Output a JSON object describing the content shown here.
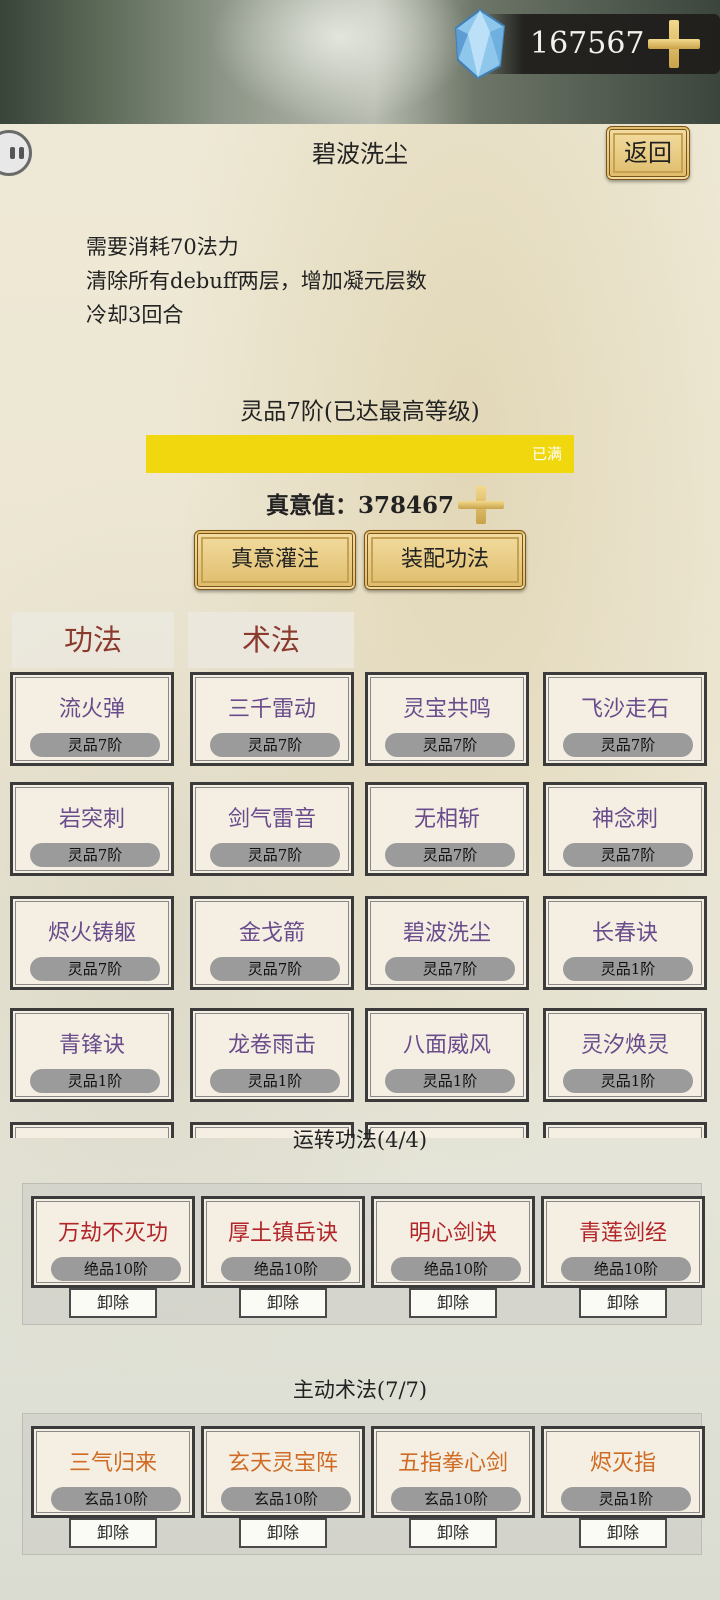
{
  "currency": {
    "value": "167567",
    "icon": "diamond-gem-icon",
    "add_icon": "plus-icon"
  },
  "skill": {
    "title": "碧波洗尘",
    "back_label": "返回",
    "description": [
      "需要消耗70法力",
      "清除所有debuff两层，增加凝元层数",
      "冷却3回合"
    ],
    "level_title": "灵品7阶(已达最高等级)",
    "progress": {
      "fraction": 1.0,
      "label": "已满",
      "fill_color": "#f0d70e"
    },
    "essence_label": "真意值：",
    "essence_value": "378467",
    "infuse_label": "真意灌注",
    "equip_label": "装配功法"
  },
  "tabs": [
    "功法",
    "术法"
  ],
  "skills": [
    {
      "name": "流火弹",
      "grade": "灵品7阶"
    },
    {
      "name": "三千雷动",
      "grade": "灵品7阶"
    },
    {
      "name": "灵宝共鸣",
      "grade": "灵品7阶"
    },
    {
      "name": "飞沙走石",
      "grade": "灵品7阶"
    },
    {
      "name": "岩突刺",
      "grade": "灵品7阶"
    },
    {
      "name": "剑气雷音",
      "grade": "灵品7阶"
    },
    {
      "name": "无相斩",
      "grade": "灵品7阶"
    },
    {
      "name": "神念刺",
      "grade": "灵品7阶"
    },
    {
      "name": "烬火铸躯",
      "grade": "灵品7阶"
    },
    {
      "name": "金戈箭",
      "grade": "灵品7阶"
    },
    {
      "name": "碧波洗尘",
      "grade": "灵品7阶"
    },
    {
      "name": "长春诀",
      "grade": "灵品1阶"
    },
    {
      "name": "青锋诀",
      "grade": "灵品1阶"
    },
    {
      "name": "龙卷雨击",
      "grade": "灵品1阶"
    },
    {
      "name": "八面威风",
      "grade": "灵品1阶"
    },
    {
      "name": "灵汐焕灵",
      "grade": "灵品1阶"
    }
  ],
  "running": {
    "title": "运转功法(4/4)",
    "items": [
      {
        "name": "万劫不灭功",
        "grade": "绝品10阶",
        "remove": "卸除"
      },
      {
        "name": "厚土镇岳诀",
        "grade": "绝品10阶",
        "remove": "卸除"
      },
      {
        "name": "明心剑诀",
        "grade": "绝品10阶",
        "remove": "卸除"
      },
      {
        "name": "青莲剑经",
        "grade": "绝品10阶",
        "remove": "卸除"
      }
    ]
  },
  "active": {
    "title": "主动术法(7/7)",
    "items": [
      {
        "name": "三气归来",
        "grade": "玄品10阶",
        "remove": "卸除"
      },
      {
        "name": "玄天灵宝阵",
        "grade": "玄品10阶",
        "remove": "卸除"
      },
      {
        "name": "五指拳心剑",
        "grade": "玄品10阶",
        "remove": "卸除"
      },
      {
        "name": "烬灭指",
        "grade": "灵品1阶",
        "remove": "卸除"
      }
    ]
  }
}
